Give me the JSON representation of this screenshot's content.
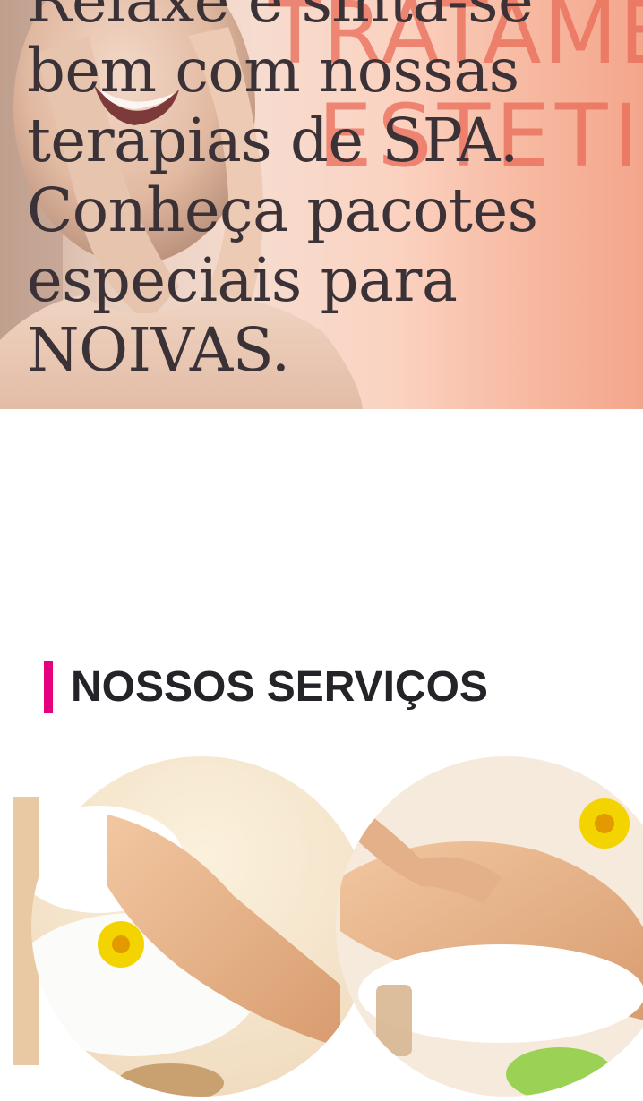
{
  "hero": {
    "headline": "Relaxe e sinta-se bem com nossas terapias de SPA. Conheça pacotes especiais para NOIVAS.",
    "background_overlay_text": "TRATAMENTOS ESTETICOS",
    "overlay_color": "#d94a3a",
    "text_color": "#3a3237"
  },
  "services": {
    "title": "NOSSOS SERVIÇOS",
    "accent_color": "#e5007e"
  }
}
